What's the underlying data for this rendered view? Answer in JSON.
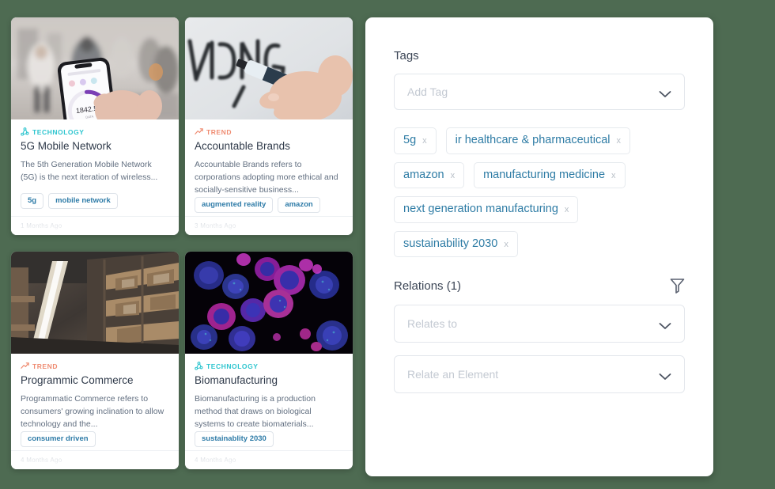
{
  "theme": {
    "background": "#4e6b52",
    "panel_bg": "#ffffff",
    "tag_text": "#2e7ca5",
    "category_tech": "#2ec5cf",
    "category_trend": "#ef8c72",
    "title_text": "#2f3a4a",
    "body_text": "#626f80",
    "placeholder": "#c3c9d2"
  },
  "cards": [
    {
      "category": "TECHNOLOGY",
      "category_icon": "tech-node-icon",
      "category_type": "tech",
      "title": "5G Mobile Network",
      "description": "The 5th Generation Mobile Network (5G) is the next iteration of wireless...",
      "tags": [
        "5g",
        "mobile network"
      ],
      "timestamp": "1 Months Ago",
      "image_alt": "hand-holding-phone-street-photo",
      "image_value": "1842.56"
    },
    {
      "category": "TREND",
      "category_icon": "trend-arrow-icon",
      "category_type": "trend",
      "title": "Accountable Brands",
      "description": "Accountable Brands refers to corporations adopting more ethical and socially-sensitive business...",
      "tags": [
        "augmented reality",
        "amazon"
      ],
      "timestamp": "3 Months Ago",
      "image_alt": "hand-writing-audience-on-whiteboard"
    },
    {
      "category": "TREND",
      "category_icon": "trend-arrow-icon",
      "category_type": "trend",
      "title": "Programmic Commerce",
      "description": "Programmatic Commerce refers to consumers' growing inclination to allow technology and the...",
      "tags": [
        "consumer driven"
      ],
      "timestamp": "4 Months Ago",
      "image_alt": "warehouse-pallet-racking-photo"
    },
    {
      "category": "TECHNOLOGY",
      "category_icon": "tech-node-icon",
      "category_type": "tech",
      "title": "Biomanufacturing",
      "description": "Biomanufacturing is a production method that draws on biological systems to create biomaterials...",
      "tags": [
        "sustainablity 2030"
      ],
      "timestamp": "4 Months Ago",
      "image_alt": "fluorescent-microscopy-cells-photo"
    }
  ],
  "panel": {
    "tags_section": {
      "heading": "Tags",
      "add_tag_placeholder": "Add Tag",
      "chips": [
        {
          "label": "5g",
          "remove": "x"
        },
        {
          "label": "ir healthcare & pharmaceutical",
          "remove": "x"
        },
        {
          "label": "amazon",
          "remove": "x"
        },
        {
          "label": "manufacturing medicine",
          "remove": "x"
        },
        {
          "label": "next generation manufacturing",
          "remove": "x"
        },
        {
          "label": "sustainability 2030",
          "remove": "x"
        }
      ]
    },
    "relations_section": {
      "heading": "Relations (1)",
      "filter_icon": "funnel-filter-icon",
      "relates_to_placeholder": "Relates to",
      "relate_element_placeholder": "Relate an Element"
    }
  }
}
